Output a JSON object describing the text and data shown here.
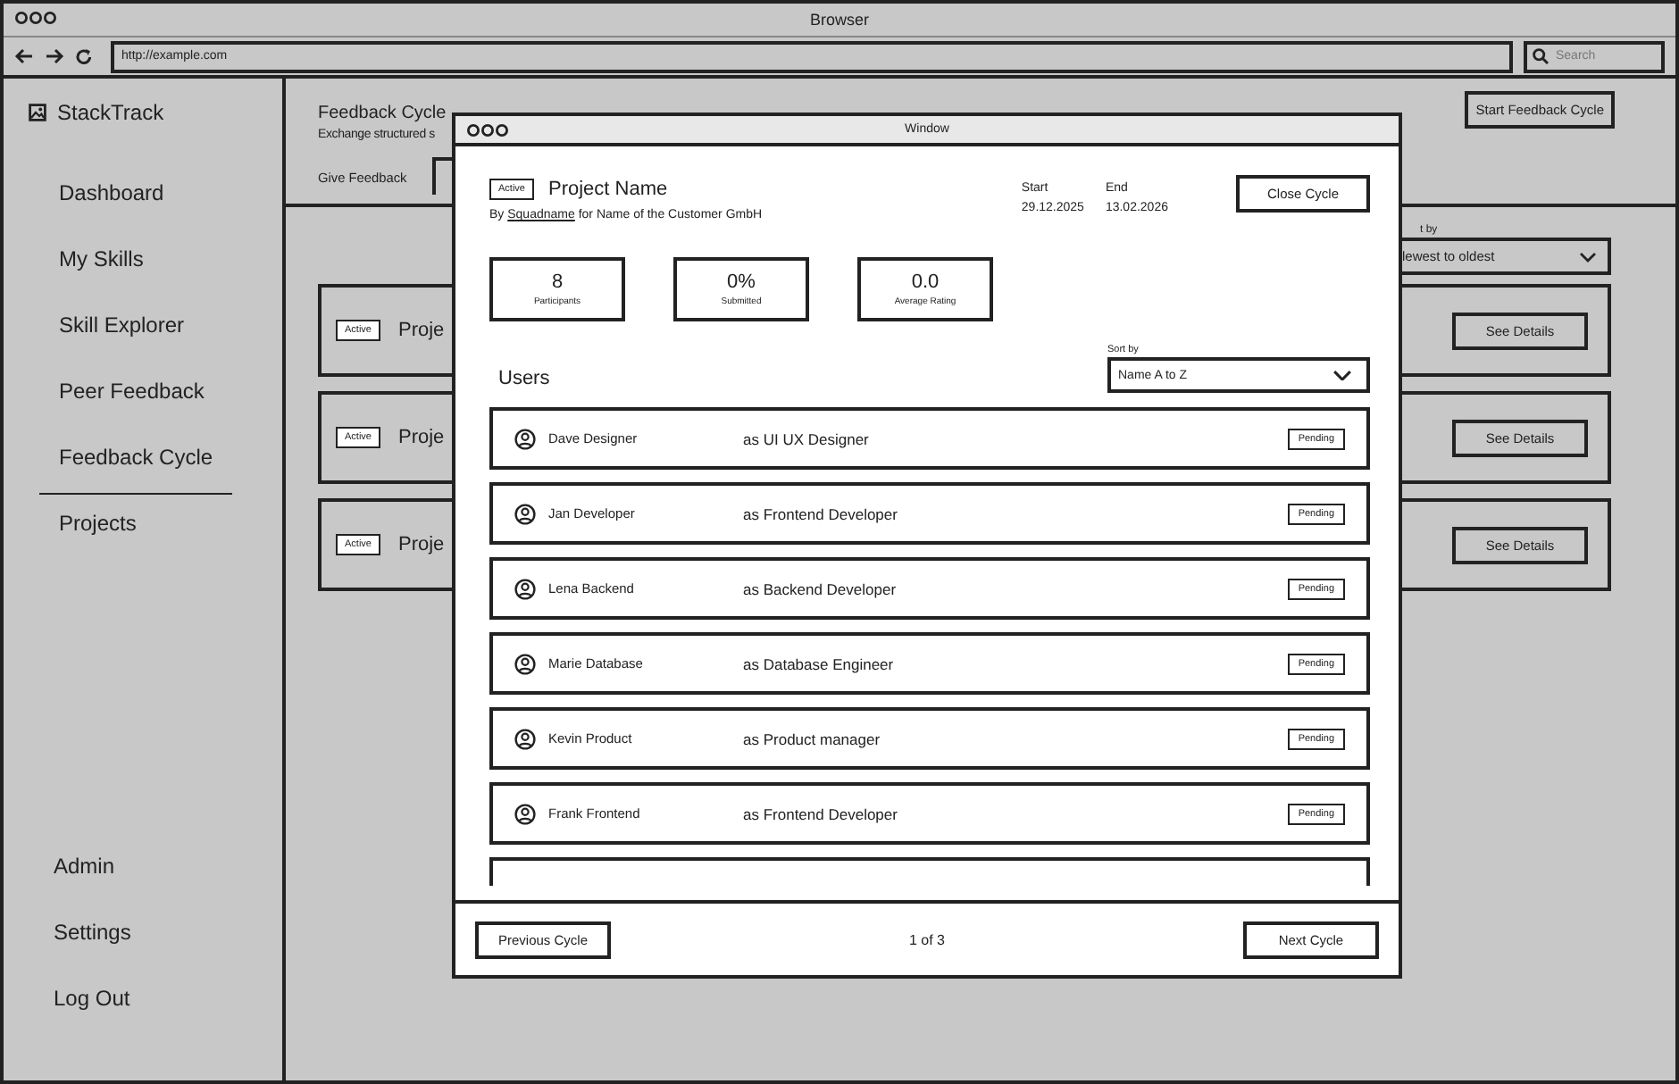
{
  "browser": {
    "title": "Browser",
    "address": "http://example.com",
    "search_placeholder": "Search"
  },
  "sidebar": {
    "brand": "StackTrack",
    "items": [
      {
        "label": "Dashboard",
        "selected": false
      },
      {
        "label": "My Skills",
        "selected": false
      },
      {
        "label": "Skill Explorer",
        "selected": false
      },
      {
        "label": "Peer Feedback",
        "selected": false
      },
      {
        "label": "Feedback Cycle",
        "selected": true
      },
      {
        "label": "Projects",
        "selected": false
      }
    ],
    "bottom_items": [
      "Admin",
      "Settings",
      "Log Out"
    ]
  },
  "page": {
    "title": "Feedback Cycle",
    "subtitle": "Exchange structured s",
    "tabs": [
      {
        "label": "Give Feedback",
        "selected": false
      },
      {
        "selected": true
      }
    ],
    "start_button": "Start Feedback Cycle",
    "sort_label": "t by",
    "sort_value": "lewest to oldest",
    "cards": [
      {
        "status": "Active",
        "name": "Proje",
        "button": "See Details"
      },
      {
        "status": "Active",
        "name": "Proje",
        "button": "See Details"
      },
      {
        "status": "Active",
        "name": "Proje",
        "button": "See Details"
      }
    ]
  },
  "modal": {
    "title": "Window",
    "status": "Active",
    "project": "Project Name",
    "by": "By",
    "squad": "Squadname",
    "for_text": "for Name of the Customer GmbH",
    "start_label": "Start",
    "start_date": "29.12.2025",
    "end_label": "End",
    "end_date": "13.02.2026",
    "close_button": "Close Cycle",
    "stats": [
      {
        "value": "8",
        "label": "Participants"
      },
      {
        "value": "0%",
        "label": "Submitted"
      },
      {
        "value": "0.0",
        "label": "Average Rating"
      }
    ],
    "users_heading": "Users",
    "sort_label": "Sort by",
    "sort_value": "Name A to Z",
    "users": [
      {
        "name": "Dave Designer",
        "role": "as UI UX Designer",
        "status": "Pending"
      },
      {
        "name": "Jan Developer",
        "role": "as Frontend Developer",
        "status": "Pending"
      },
      {
        "name": "Lena Backend",
        "role": "as Backend Developer",
        "status": "Pending"
      },
      {
        "name": "Marie Database",
        "role": "as Database Engineer",
        "status": "Pending"
      },
      {
        "name": "Kevin Product",
        "role": "as Product manager",
        "status": "Pending"
      },
      {
        "name": "Frank Frontend",
        "role": "as Frontend Developer",
        "status": "Pending"
      }
    ],
    "prev_button": "Previous Cycle",
    "pager": "1 of 3",
    "next_button": "Next Cycle"
  }
}
